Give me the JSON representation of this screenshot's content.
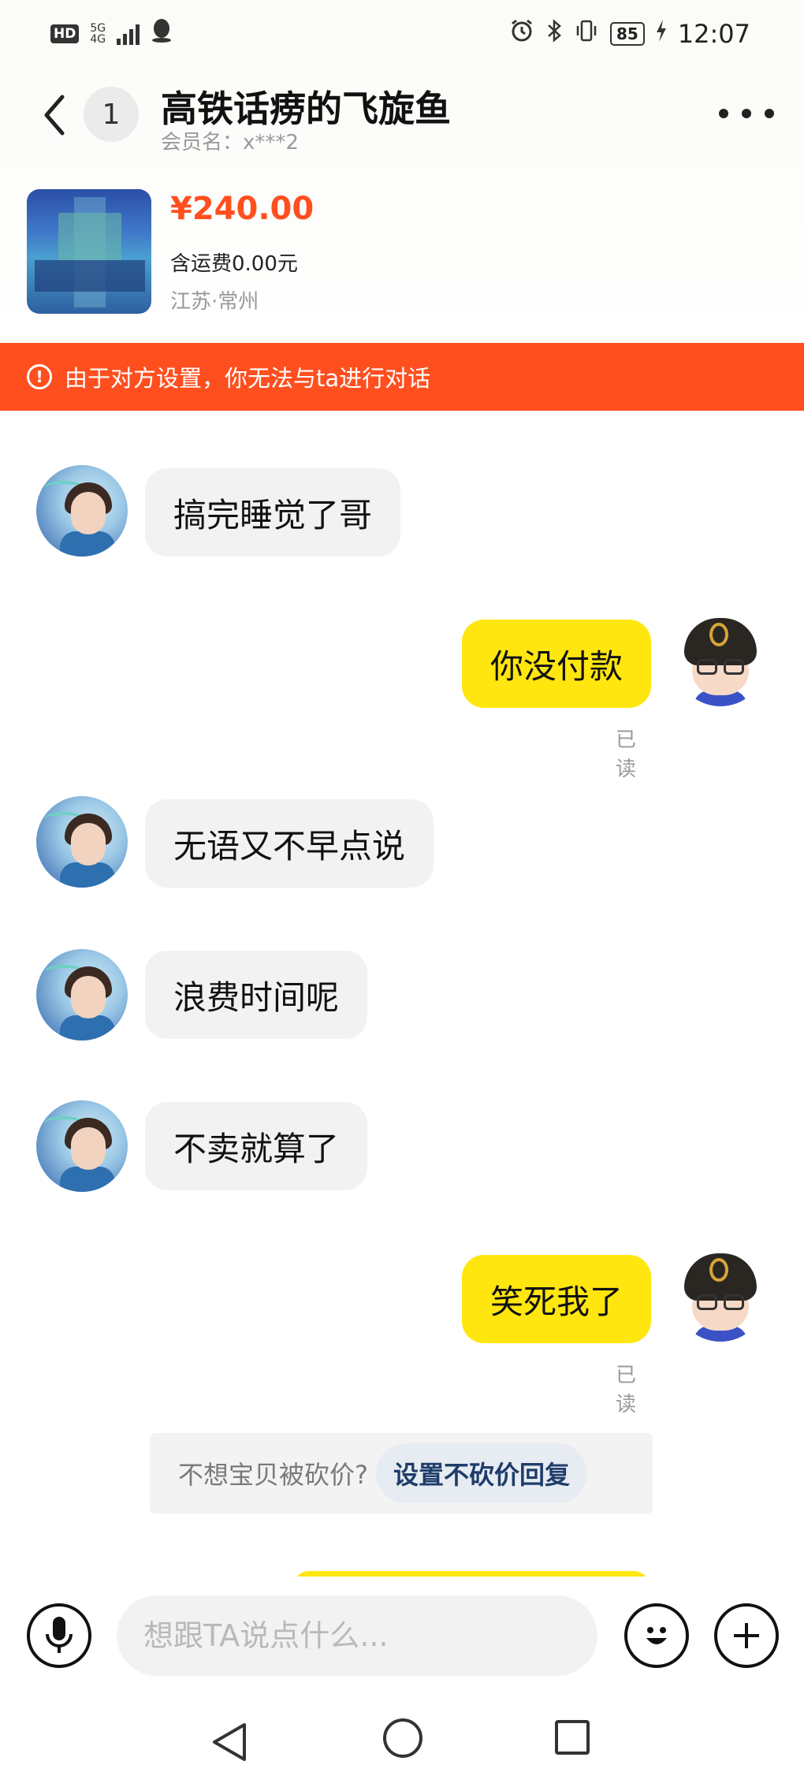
{
  "status_bar": {
    "hd": "HD",
    "network": "5G",
    "network_sub": "4G",
    "battery": "85",
    "time": "12:07"
  },
  "header": {
    "unread_count": "1",
    "title": "高铁话痨的飞旋鱼",
    "subtitle": "会员名：x***2"
  },
  "product": {
    "price": "¥240.00",
    "shipping": "含运费0.00元",
    "location": "江苏·常州"
  },
  "banner": {
    "icon": "!",
    "text": "由于对方设置，你无法与ta进行对话"
  },
  "messages": [
    {
      "side": "other",
      "text": "搞完睡觉了哥"
    },
    {
      "side": "me",
      "text": "你没付款",
      "status": "已读"
    },
    {
      "side": "other",
      "text": "无语又不早点说"
    },
    {
      "side": "other",
      "text": "浪费时间呢"
    },
    {
      "side": "other",
      "text": "不卖就算了"
    },
    {
      "side": "me",
      "text": "笑死我了",
      "status": "已读"
    }
  ],
  "tip": {
    "text": "不想宝贝被砍价?",
    "button": "设置不砍价回复"
  },
  "input": {
    "placeholder": "想跟TA说点什么..."
  },
  "colors": {
    "accent_orange": "#ff4f1f",
    "my_bubble": "#ffe60f",
    "other_bubble": "#f2f2f2"
  }
}
